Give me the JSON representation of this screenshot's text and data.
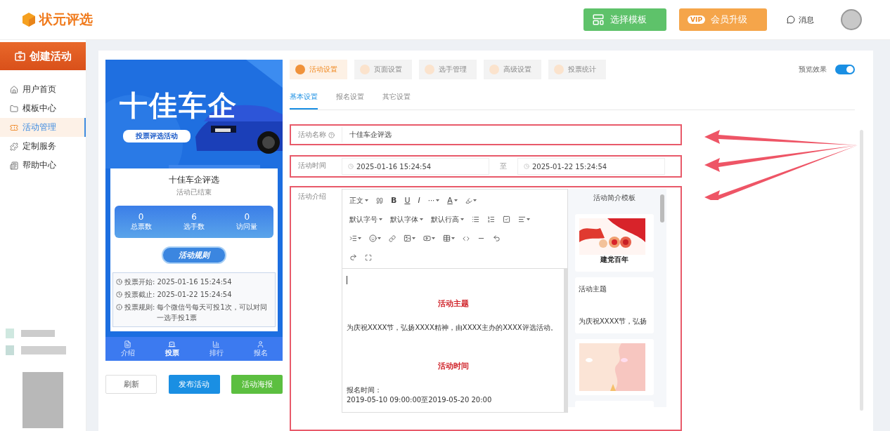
{
  "header": {
    "logo": "状元评选",
    "buttons": [
      {
        "kind": "template",
        "label": "选择模板"
      },
      {
        "kind": "vip",
        "badge": "VIP",
        "label": "会员升级"
      }
    ],
    "message": "消息"
  },
  "sidebar": {
    "create": "创建活动",
    "items": [
      {
        "label": "用户首页",
        "selected": false
      },
      {
        "label": "模板中心",
        "selected": false
      },
      {
        "label": "活动管理",
        "selected": true
      },
      {
        "label": "定制服务",
        "selected": false
      },
      {
        "label": "帮助中心",
        "selected": false
      }
    ]
  },
  "preview": {
    "banner_title": "十佳车企",
    "banner_tag": "投票评选活动",
    "title": "十佳车企评选",
    "status": "活动已结束",
    "stats": [
      {
        "value": "0",
        "label": "总票数"
      },
      {
        "value": "6",
        "label": "选手数"
      },
      {
        "value": "0",
        "label": "访问量"
      }
    ],
    "rules_title": "活动规则",
    "rules": [
      {
        "kind": "clock",
        "label": "投票开始:",
        "value": "2025-01-16 15:24:54"
      },
      {
        "kind": "clock",
        "label": "投票截止:",
        "value": "2025-01-22 15:24:54"
      },
      {
        "kind": "info",
        "label": "投票规则:",
        "value": "每个微信号每天可投1次，可以对同一选手投1票"
      }
    ],
    "nav": [
      {
        "label": "介绍",
        "selected": false
      },
      {
        "label": "投票",
        "selected": true
      },
      {
        "label": "排行",
        "selected": false
      },
      {
        "label": "报名",
        "selected": false
      }
    ]
  },
  "actions": [
    {
      "kind": "plain",
      "label": "刷新"
    },
    {
      "kind": "primary",
      "label": "发布活动"
    },
    {
      "kind": "success",
      "label": "活动海报"
    }
  ],
  "tabs": [
    {
      "label": "活动设置",
      "selected": true
    },
    {
      "label": "页面设置",
      "selected": false
    },
    {
      "label": "选手管理",
      "selected": false
    },
    {
      "label": "高级设置",
      "selected": false
    },
    {
      "label": "投票统计",
      "selected": false
    }
  ],
  "preview_toggle": {
    "label": "预览效果",
    "on": true
  },
  "subtabs": [
    {
      "label": "基本设置",
      "selected": true
    },
    {
      "label": "报名设置",
      "selected": false
    },
    {
      "label": "其它设置",
      "selected": false
    }
  ],
  "form": {
    "name_label": "活动名称",
    "name_value": "十佳车企评选",
    "time_label": "活动时间",
    "start": "2025-01-16 15:24:54",
    "separator": "至",
    "end": "2025-01-22 15:24:54",
    "intro_label": "活动介绍"
  },
  "editor": {
    "toolbar": [
      "正文",
      "B",
      "U",
      "I",
      "···",
      "A",
      "默认字号",
      "默认字体",
      "默认行高"
    ],
    "content": [
      {
        "kind": "heading",
        "text": "活动主题"
      },
      {
        "kind": "para",
        "text": "为庆祝XXXX节，弘扬XXXX精神，由XXXX主办的XXXX评选活动。"
      },
      {
        "kind": "heading",
        "text": "活动时间"
      },
      {
        "kind": "para",
        "text": "报名时间："
      },
      {
        "kind": "para",
        "text": "2019-05-10 09:00:00至2019-05-20 20:00"
      }
    ]
  },
  "templates": {
    "title": "活动简介模板",
    "items": [
      {
        "kind": "picture",
        "caption": "建党百年"
      },
      {
        "kind": "text",
        "title": "活动主题",
        "body": "为庆祝XXXX节，弘扬"
      },
      {
        "kind": "picture"
      },
      {
        "kind": "blank"
      }
    ]
  }
}
